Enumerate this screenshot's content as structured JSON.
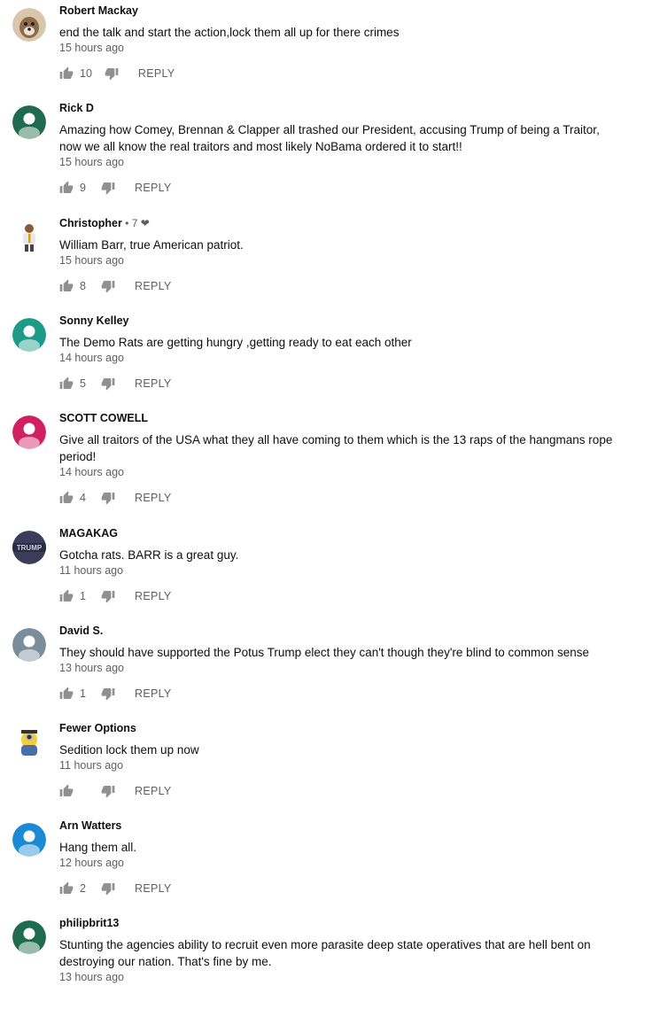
{
  "comments": [
    {
      "author": "Robert Mackay",
      "extra": "",
      "text": "end the talk and start the action,lock them all up for there crimes",
      "time": "15 hours ago",
      "likes": "10",
      "reply": "REPLY",
      "avatar": {
        "kind": "photo-dog",
        "color": "#8b6b4a"
      }
    },
    {
      "author": "Rick D",
      "extra": "",
      "text": "Amazing how Comey, Brennan & Clapper all trashed our President, accusing Trump of being a Traitor, now we all know the real traitors and most likely NoBama ordered it to start!!",
      "time": "15 hours ago",
      "likes": "9",
      "reply": "REPLY",
      "avatar": {
        "kind": "default",
        "color": "#1f6b4f"
      }
    },
    {
      "author": "Christopher",
      "extra": " • 7 ❤",
      "text": "William Barr, true American patriot.",
      "time": "15 hours ago",
      "likes": "8",
      "reply": "REPLY",
      "avatar": {
        "kind": "cartoon-man",
        "color": "#ffffff"
      }
    },
    {
      "author": "Sonny Kelley",
      "extra": "",
      "text": "The Demo Rats are getting hungry ,getting ready to eat each other",
      "time": "14 hours ago",
      "likes": "5",
      "reply": "REPLY",
      "avatar": {
        "kind": "default",
        "color": "#1e9b88"
      }
    },
    {
      "author": "SCOTT COWELL",
      "extra": "",
      "text": "Give all traitors of the USA what they all have coming to them which is the 13 raps of the hangmans rope period!",
      "time": "14 hours ago",
      "likes": "4",
      "reply": "REPLY",
      "avatar": {
        "kind": "default",
        "color": "#d01f62"
      }
    },
    {
      "author": "MAGAKAG",
      "extra": "",
      "text": "Gotcha rats. BARR is a great guy.",
      "time": "11 hours ago",
      "likes": "1",
      "reply": "REPLY",
      "avatar": {
        "kind": "photo-trump",
        "color": "#3a3c5a",
        "text": "TRUMP"
      }
    },
    {
      "author": "David S.",
      "extra": "",
      "text": "They should have supported the Potus Trump elect they can't though they're blind to common sense",
      "time": "13 hours ago",
      "likes": "1",
      "reply": "REPLY",
      "avatar": {
        "kind": "default",
        "color": "#7b8d9b"
      }
    },
    {
      "author": "Fewer Options",
      "extra": "",
      "text": "Sedition lock them up now",
      "time": "11 hours ago",
      "likes": "",
      "reply": "REPLY",
      "avatar": {
        "kind": "cartoon-minion",
        "color": "#ffffff"
      }
    },
    {
      "author": "Arn Watters",
      "extra": "",
      "text": "Hang them all.",
      "time": "12 hours ago",
      "likes": "2",
      "reply": "REPLY",
      "avatar": {
        "kind": "default",
        "color": "#1a8ad4"
      }
    },
    {
      "author": "philipbrit13",
      "extra": "",
      "text": "Stunting the agencies ability to recruit even more parasite deep state operatives that are hell bent on destroying our nation.    That's fine by me.",
      "time": "13 hours ago",
      "likes": "",
      "reply": "",
      "avatar": {
        "kind": "default",
        "color": "#1f6b4f"
      }
    }
  ],
  "icons": {
    "like": "thumbs-up-icon",
    "dislike": "thumbs-down-icon"
  }
}
